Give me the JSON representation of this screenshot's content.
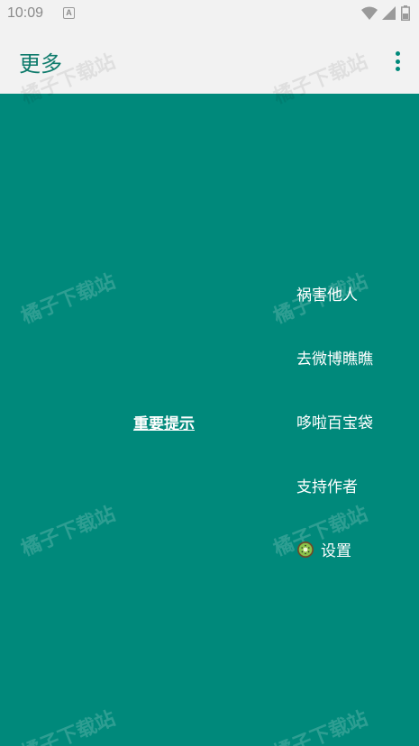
{
  "status_bar": {
    "time": "10:09",
    "notification_icon": "a-icon",
    "wifi_icon": "wifi-icon",
    "signal_icon": "signal-icon",
    "battery_icon": "battery-icon"
  },
  "app_bar": {
    "title": "更多",
    "overflow_icon": "more-vert-icon"
  },
  "main": {
    "notice_link": "重要提示",
    "menu_items": [
      {
        "label": "祸害他人"
      },
      {
        "label": "去微博瞧瞧"
      },
      {
        "label": "哆啦百宝袋"
      },
      {
        "label": "支持作者"
      },
      {
        "label": "设置",
        "icon": "kiwi-icon"
      }
    ]
  },
  "watermark": "橘子下载站",
  "colors": {
    "background": "#00897b",
    "app_bar": "#f2f2f2",
    "accent": "#0f7b6c",
    "text_on_bg": "#ffffff"
  }
}
